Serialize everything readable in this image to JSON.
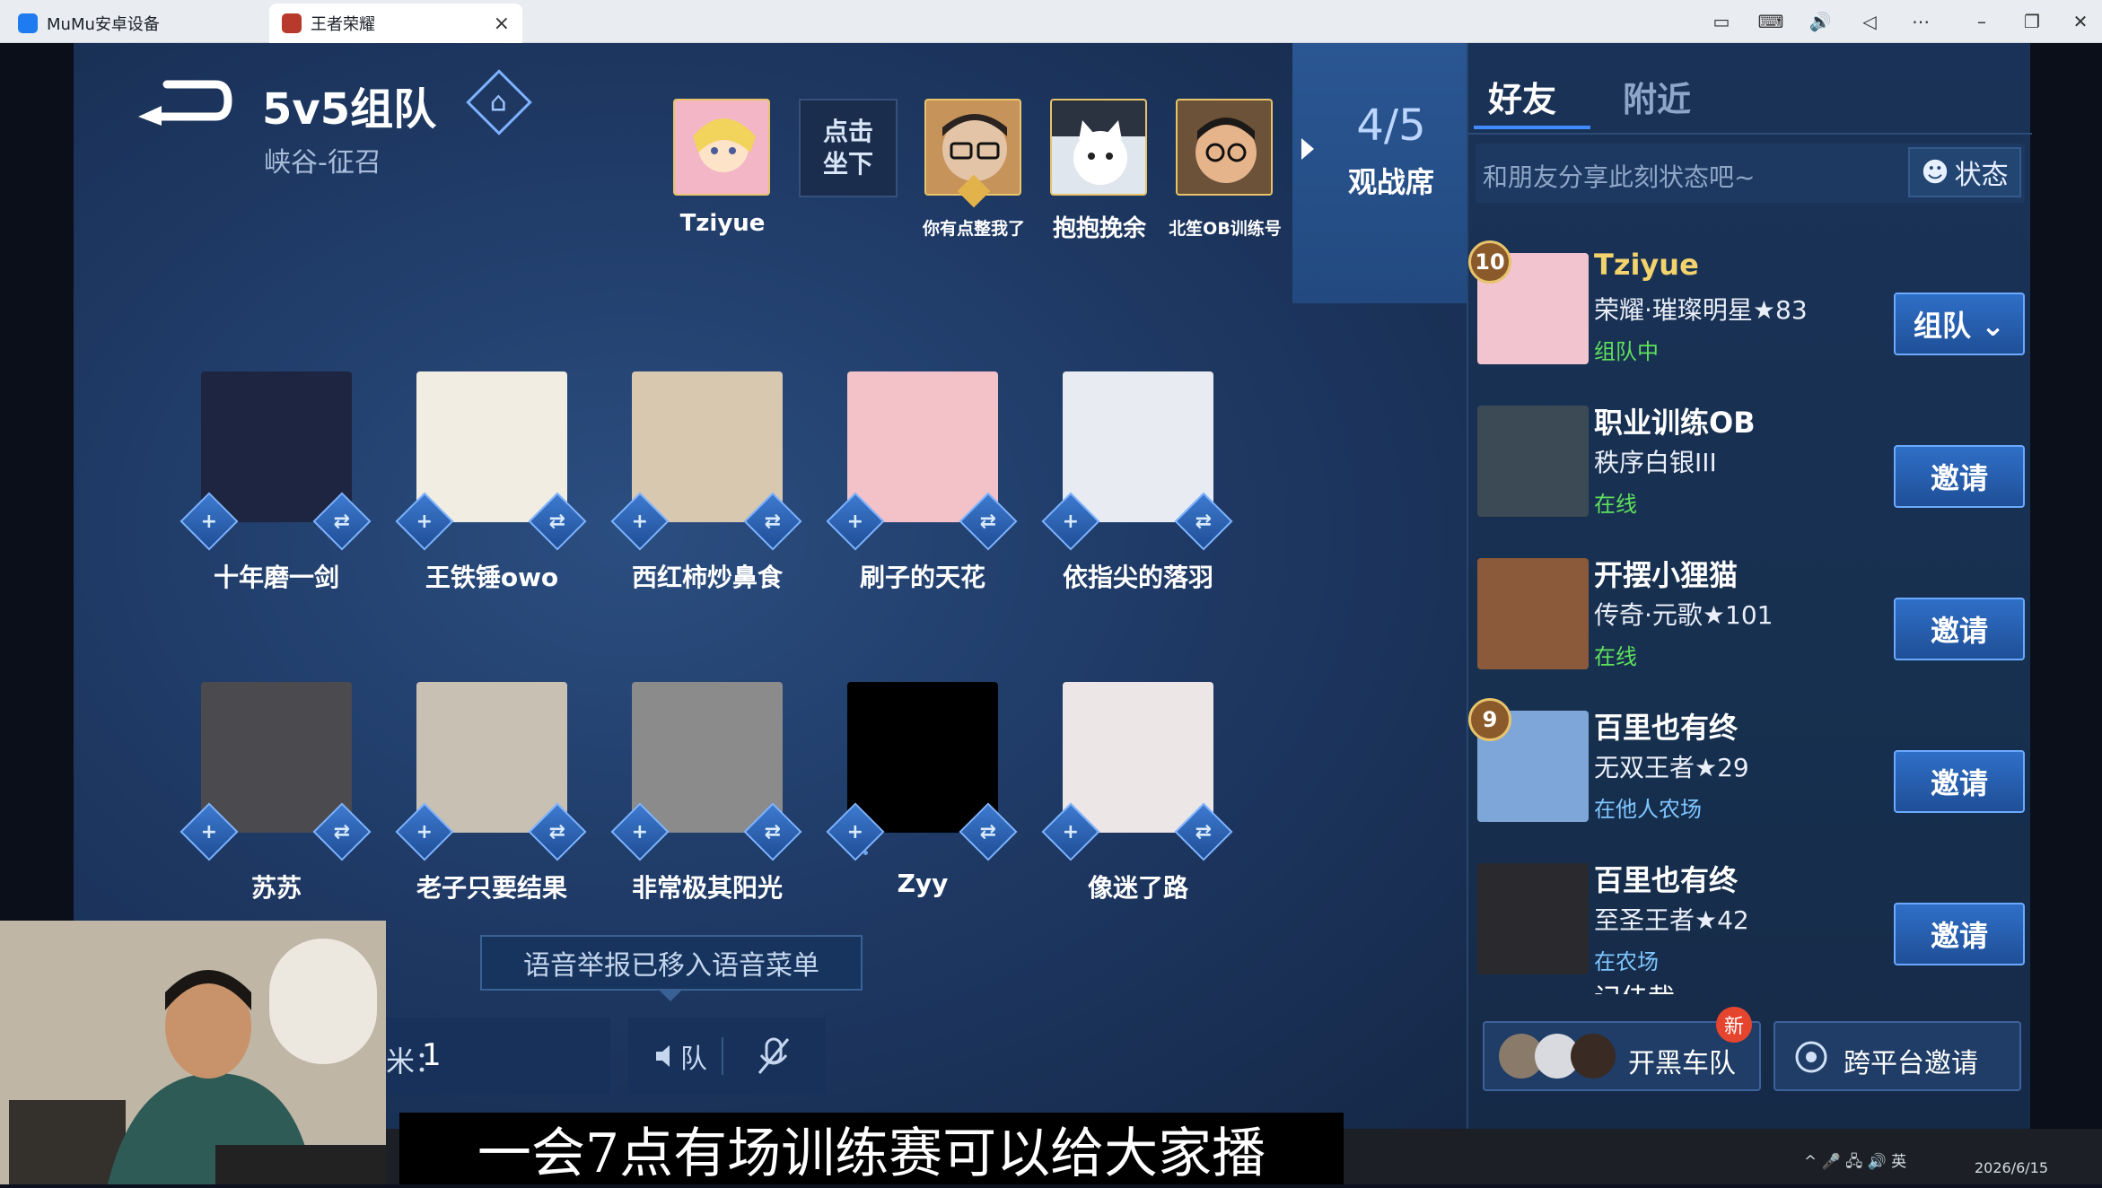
{
  "window": {
    "tabs": [
      {
        "label": "MuMu安卓设备",
        "active": false
      },
      {
        "label": "王者荣耀",
        "active": true
      }
    ],
    "tab_close": "×",
    "controls": [
      "▭",
      "⌨",
      "🔊",
      "◁",
      "⋯",
      "–",
      "❐",
      "✕"
    ]
  },
  "room": {
    "back_icon": "back-arrow-icon",
    "title": "5v5组队",
    "subtitle": "峡谷-征召",
    "home_icon": "⌂",
    "top_seats": [
      {
        "name": "Tziyue",
        "avatar_color": "#f2b6c6"
      },
      {
        "name": "点击坐下",
        "empty": true
      },
      {
        "name": "你有点整我了",
        "avatar_color": "#c6935a"
      },
      {
        "name": "抱抱挽余",
        "avatar_color": "#e0e6ee"
      },
      {
        "name": "北笙OB训练号",
        "avatar_color": "#6b5238"
      }
    ],
    "empty_seat_line1": "点击",
    "empty_seat_line2": "坐下",
    "spectator_count": "4/5",
    "spectator_label": "观战席",
    "row1": [
      {
        "name": "十年磨一剑",
        "color": "#1d2540"
      },
      {
        "name": "王铁锤owo",
        "color": "#f1ede2"
      },
      {
        "name": "西红柿炒鼻食",
        "color": "#d9c8b0"
      },
      {
        "name": "刷子的天花",
        "color": "#f3c2c8"
      },
      {
        "name": "依指尖的落羽",
        "color": "#e8ecf2"
      }
    ],
    "row2": [
      {
        "name": "苏苏",
        "color": "#4a4a4f"
      },
      {
        "name": "老子只要结果",
        "color": "#c9c0b4"
      },
      {
        "name": "非常极其阳光",
        "color": "#8b8b8b"
      },
      {
        "name": "Zyy",
        "color": "#000000"
      },
      {
        "name": "像迷了路",
        "color": "#ece6e6"
      }
    ],
    "add_friend_glyph": "+",
    "swap_glyph": "⇄",
    "notice": "语音举报已移入语音菜单",
    "counter_label": "米：",
    "counter_value": "1",
    "voice_team_label": "队",
    "mic_icon": "mic-muted-icon"
  },
  "panel": {
    "tabs": [
      {
        "label": "好友",
        "active": true
      },
      {
        "label": "附近",
        "active": false
      }
    ],
    "status_placeholder": "和朋友分享此刻状态吧~",
    "status_button": "状态",
    "friends": [
      {
        "name": "Tziyue",
        "level_badge": "10",
        "rank": "荣耀·璀璨明星★83",
        "status": "组队中",
        "status_color": "#5fe05c",
        "button": "组队 ⌄",
        "avatar_color": "#f2c4cf"
      },
      {
        "name": "职业训练OB",
        "level_badge": "",
        "rank": "秩序白银III",
        "status": "在线",
        "status_color": "#5fe05c",
        "button": "邀请",
        "avatar_color": "#3c4a55"
      },
      {
        "name": "开摆小狸猫",
        "level_badge": "",
        "rank": "传奇·元歌★101",
        "status": "在线",
        "status_color": "#5fe05c",
        "button": "邀请",
        "avatar_color": "#8a5a3a"
      },
      {
        "name": "百里也有终",
        "level_badge": "9",
        "rank": "无双王者★29",
        "status": "在他人农场",
        "status_color": "#7fc6ff",
        "button": "邀请",
        "avatar_color": "#7fa6d8"
      },
      {
        "name": "百里也有终",
        "level_badge": "",
        "rank": "至圣王者★42",
        "status": "在农场",
        "status_color": "#7fc6ff",
        "button": "邀请",
        "avatar_color": "#2a2a2e"
      }
    ],
    "partial_name": "记佳裁",
    "new_badge": "新",
    "team_button": "开黑车队",
    "cross_button": "跨平台邀请"
  },
  "subtitle": "一会7点有场训练赛可以给大家播",
  "taskbar": {
    "tray": "^ 🎤 🖧 🔊 英",
    "date": "2026/6/15"
  }
}
